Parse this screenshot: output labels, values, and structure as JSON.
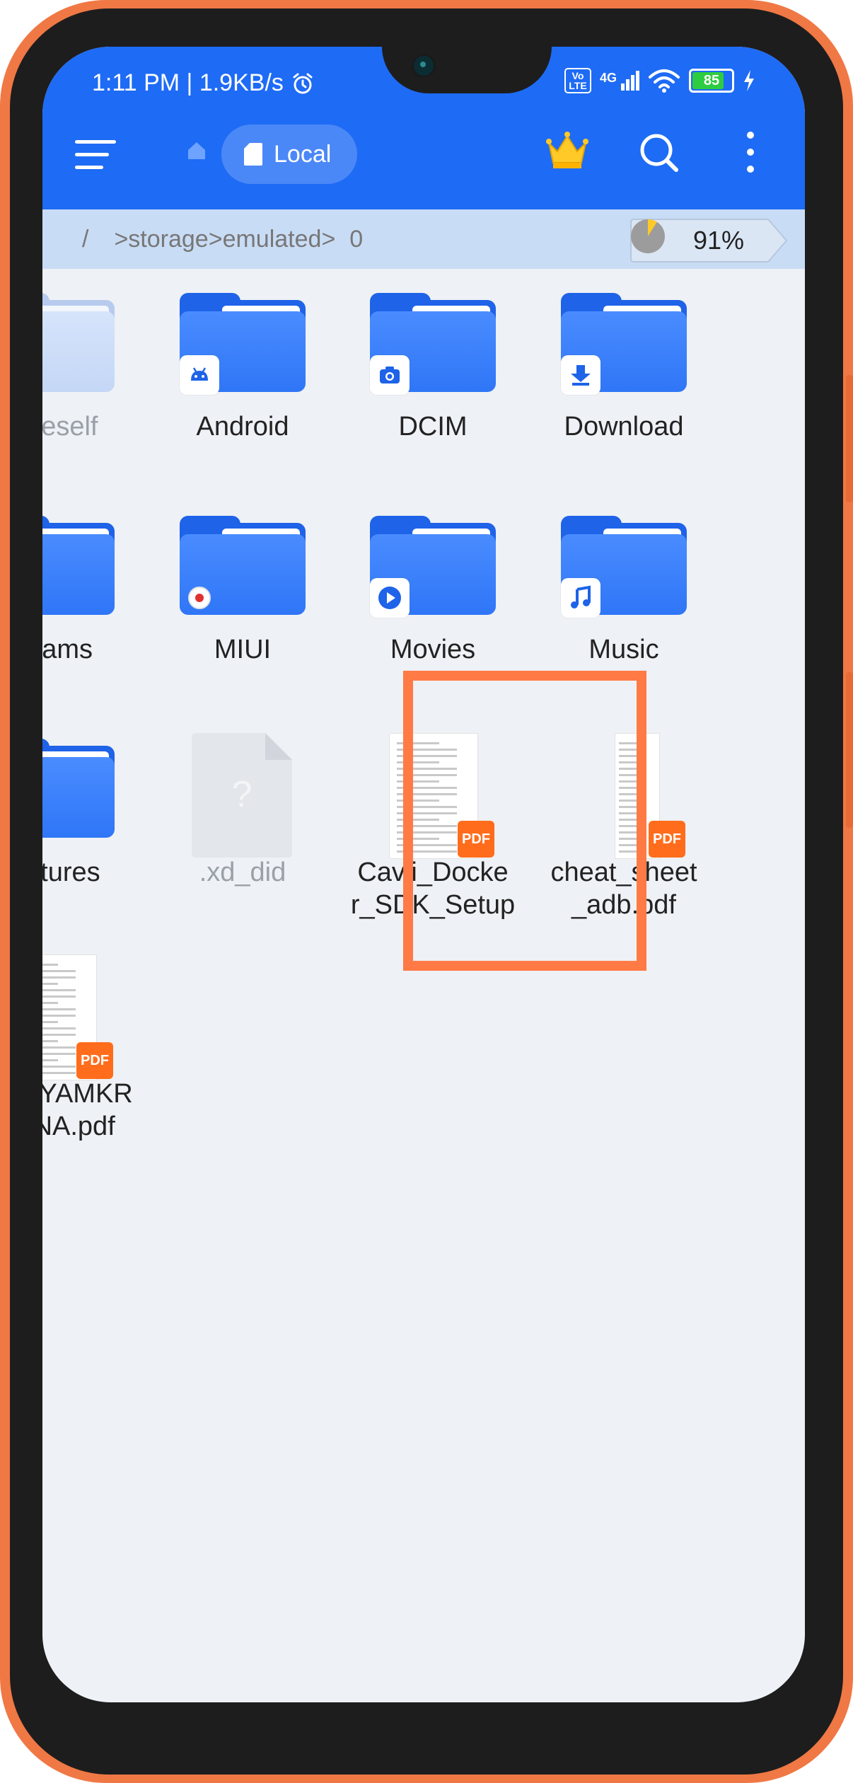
{
  "status_bar": {
    "time_speed": "1:11 PM | 1.9KB/s",
    "volte": "Vo LTE",
    "network": "4G",
    "battery": "85",
    "battery_level": 0.85
  },
  "toolbar": {
    "location_label": "Local"
  },
  "path_bar": {
    "root": "/",
    "path": ">storage>emulated>",
    "leaf": "0",
    "storage_percent": "91%",
    "storage_used_fraction": 0.91
  },
  "files": [
    {
      "name": ".aceself",
      "type": "folder",
      "faded": true,
      "badge": null
    },
    {
      "name": "Android",
      "type": "folder",
      "badge": "android-icon"
    },
    {
      "name": "DCIM",
      "type": "folder",
      "badge": "camera-icon"
    },
    {
      "name": "Download",
      "type": "folder",
      "badge": "download-icon"
    },
    {
      "name": "Exams",
      "type": "folder",
      "badge": null
    },
    {
      "name": "MIUI",
      "type": "folder",
      "badge": "record-icon"
    },
    {
      "name": "Movies",
      "type": "folder",
      "badge": "play-icon"
    },
    {
      "name": "Music",
      "type": "folder",
      "badge": "music-note-icon"
    },
    {
      "name": "Pictures",
      "type": "folder",
      "badge": "image-icon"
    },
    {
      "name": ".xd_did",
      "type": "unknown",
      "faded": true,
      "badge": "question-icon"
    },
    {
      "name": "Cavli_Docke\nr_SDK_Setup",
      "type": "pdf",
      "highlighted": true,
      "badge": "PDF"
    },
    {
      "name": "cheat_sheet\n_adb.pdf",
      "type": "pdf",
      "badge": "PDF"
    },
    {
      "name": "K S SYAMKR\nISHNA.pdf",
      "type": "pdf",
      "badge": "PDF"
    }
  ],
  "colors": {
    "accent": "#1e6bf5",
    "highlight": "#ff7a45",
    "pdf_badge": "#ff6d1c",
    "phone_frame": "#f07845"
  }
}
